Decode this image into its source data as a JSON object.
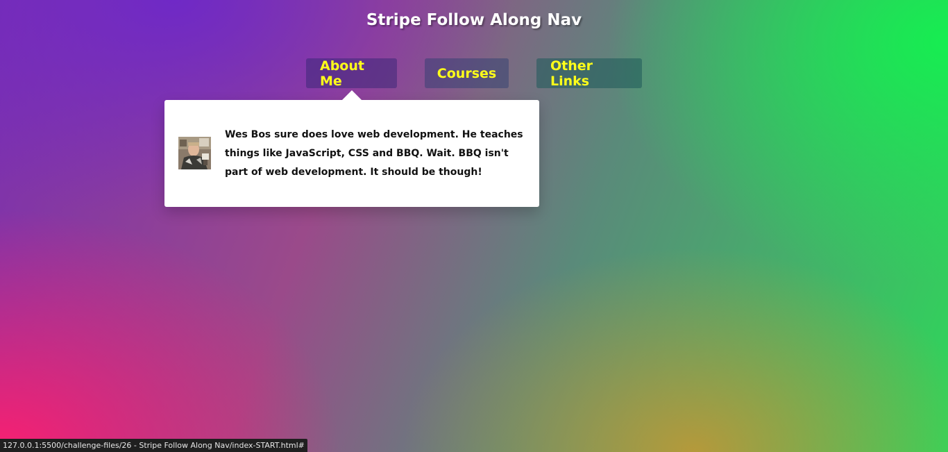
{
  "header": {
    "title": "Stripe Follow Along Nav"
  },
  "nav": {
    "items": [
      {
        "label": "About Me"
      },
      {
        "label": "Courses"
      },
      {
        "label": "Other Links"
      }
    ]
  },
  "dropdown": {
    "bio": "Wes Bos sure does love web development. He teaches things like JavaScript, CSS and BBQ. Wait. BBQ isn't part of web development. It should be though!",
    "avatar_icon": "person-photo-icon"
  },
  "status_bar": {
    "url": "127.0.0.1:5500/challenge-files/26 - Stripe Follow Along Nav/index-START.html#"
  },
  "colors": {
    "nav_text": "#ffff1a",
    "title_text": "#ffffff",
    "dropdown_bg": "#ffffff"
  }
}
